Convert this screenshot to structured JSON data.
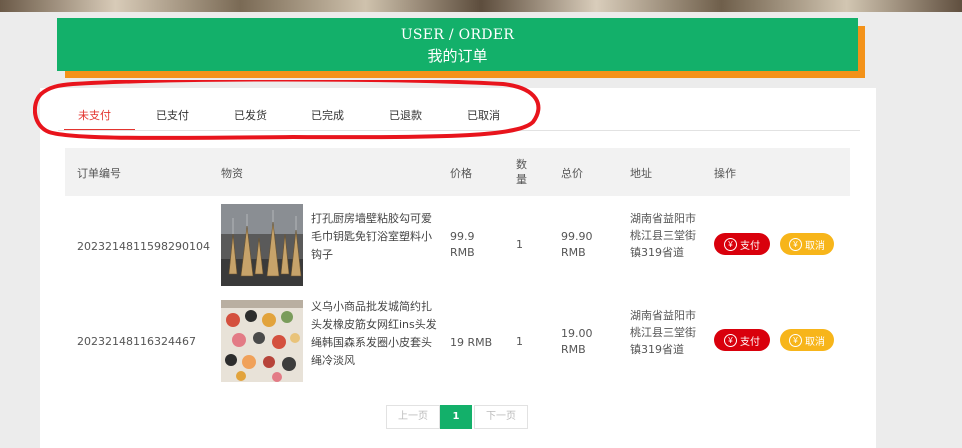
{
  "banner": {
    "title_en": "USER / ORDER",
    "title_cn": "我的订单"
  },
  "tabs": [
    {
      "label": "未支付",
      "active": true
    },
    {
      "label": "已支付",
      "active": false
    },
    {
      "label": "已发货",
      "active": false
    },
    {
      "label": "已完成",
      "active": false
    },
    {
      "label": "已退款",
      "active": false
    },
    {
      "label": "已取消",
      "active": false
    }
  ],
  "table": {
    "headers": {
      "order_no": "订单编号",
      "goods": "物资",
      "price": "价格",
      "qty": "数量",
      "total": "总价",
      "address": "地址",
      "action": "操作"
    }
  },
  "orders": [
    {
      "order_no": "2023214811598290104",
      "product_name": "打孔厨房墙壁粘胶勾可爱毛巾钥匙免钉浴室塑料小钩子",
      "price_value": "99.9",
      "price_unit": "RMB",
      "qty": "1",
      "total_value": "99.90",
      "total_unit": "RMB",
      "address": "湖南省益阳市桃江县三堂街镇319省道",
      "pay_label": "支付",
      "cancel_label": "取消",
      "image": "keychain-tower-figurines"
    },
    {
      "order_no": "20232148116324467",
      "product_name": "义乌小商品批发城简约扎头发橡皮筋女网红ins头发绳韩国森系发圈小皮套头绳冷淡风",
      "price_value": "19 RMB",
      "price_unit": "",
      "qty": "1",
      "total_value": "19.00",
      "total_unit": "RMB",
      "address": "湖南省益阳市桃江县三堂街镇319省道",
      "pay_label": "支付",
      "cancel_label": "取消",
      "image": "hair-ties-display"
    }
  ],
  "pagination": {
    "prev": "上一页",
    "current": "1",
    "next": "下一页"
  },
  "colors": {
    "banner": "#13b06a",
    "banner_shadow": "#f39219",
    "active_tab": "#e3342f",
    "pay": "#d9000c",
    "cancel": "#f7b51a",
    "annotation": "#e8141c"
  },
  "icons": {
    "pay_icon": "yen-circle-icon",
    "cancel_icon": "yen-circle-icon"
  }
}
